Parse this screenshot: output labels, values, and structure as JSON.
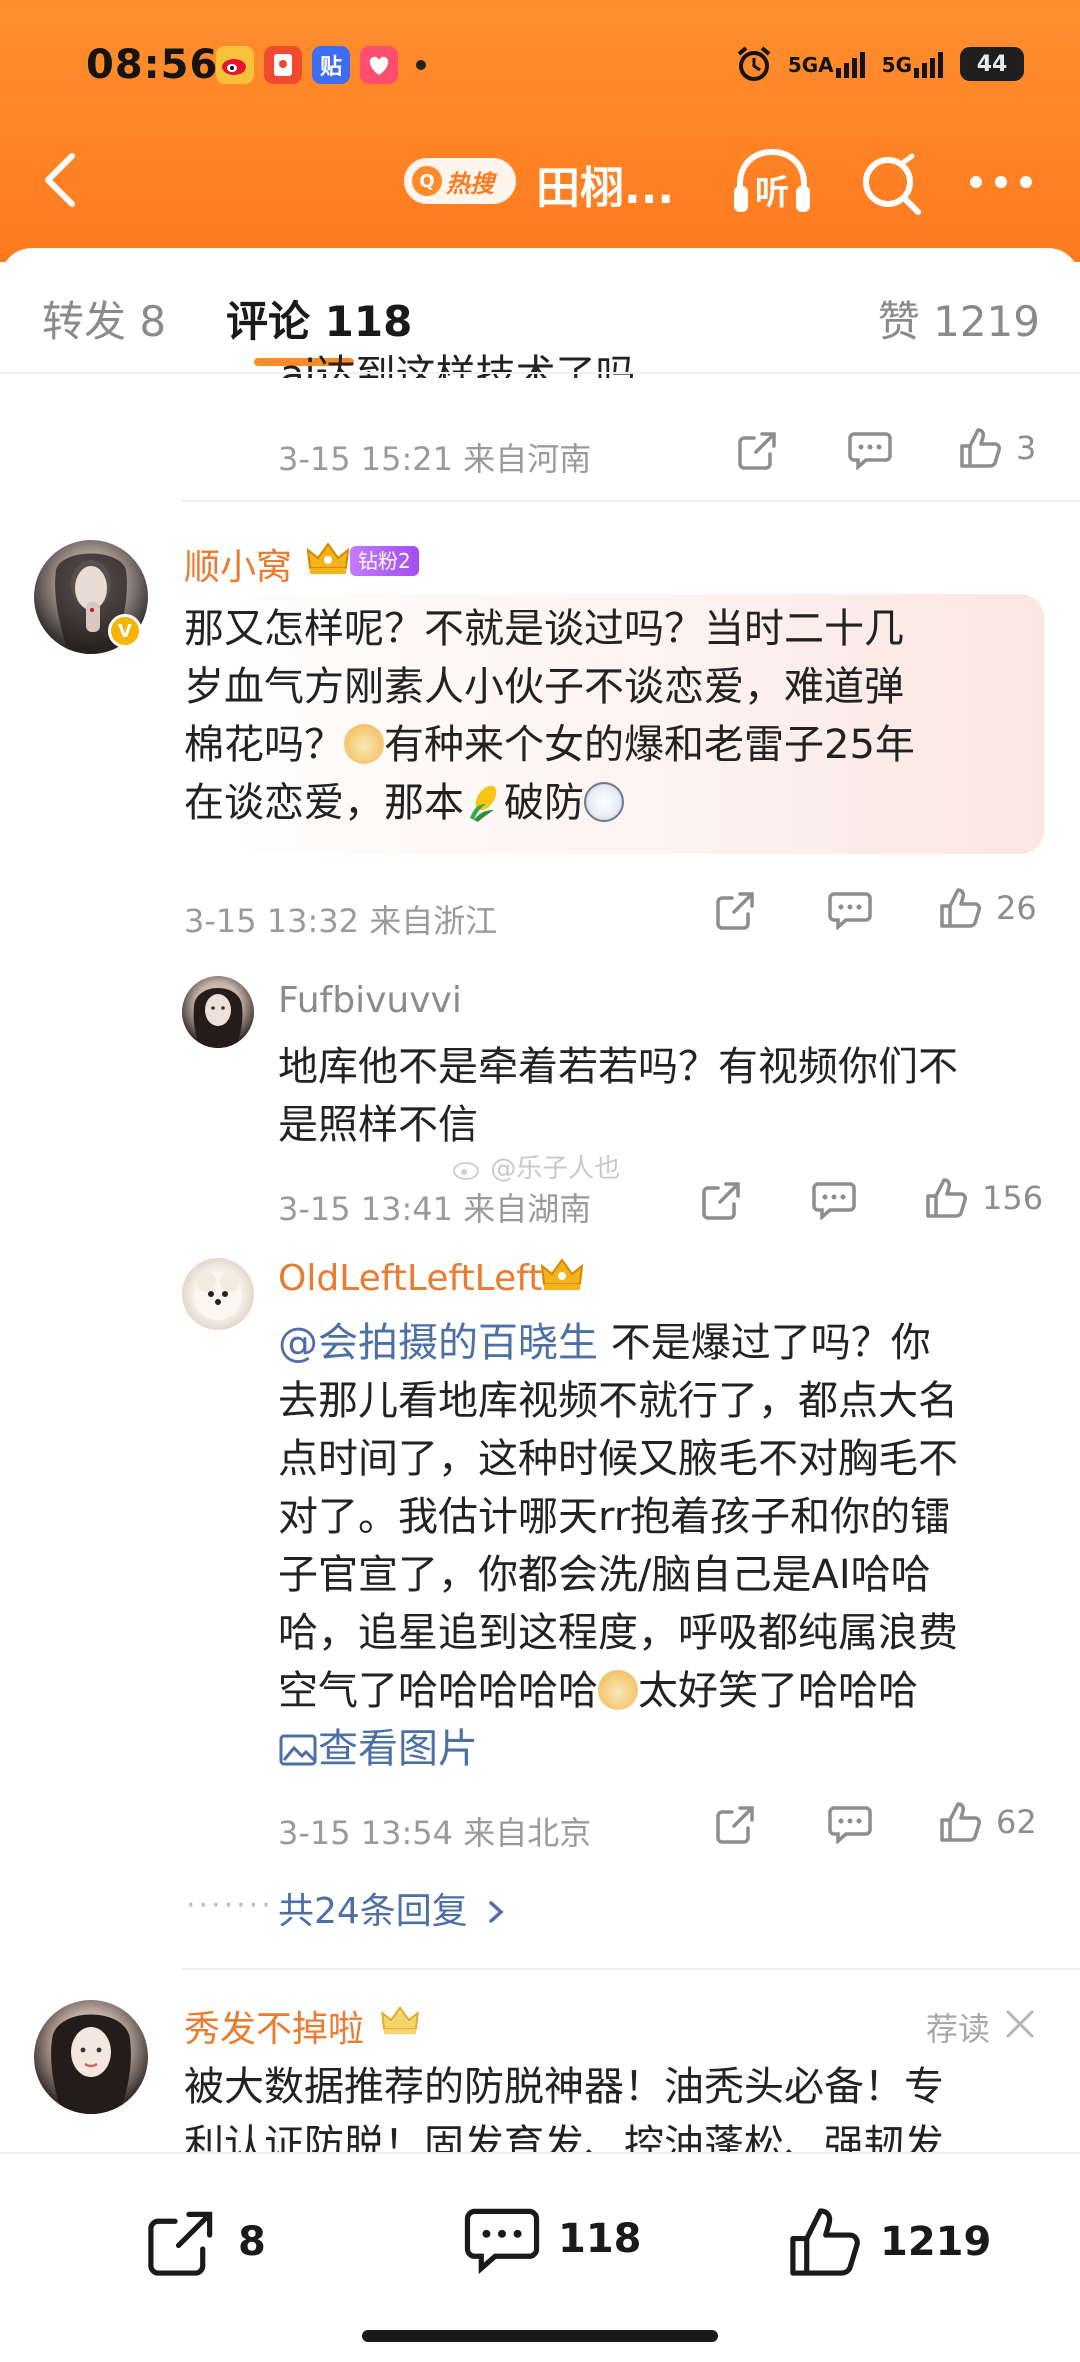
{
  "status": {
    "time": "08:56",
    "battery": "44",
    "signal1": "5GA",
    "signal2": "5G"
  },
  "nav": {
    "hot_label": "热搜",
    "title": "田栩...",
    "listen_label": "听"
  },
  "tabs": {
    "repost": "转发 8",
    "comment": "评论 118",
    "like": "赞 1219"
  },
  "prev_comment": {
    "text_cut": "ai达到这样技术了吗",
    "meta": "3-15 15:21  来自河南",
    "likes": "3"
  },
  "comments": [
    {
      "user": "顺小窝",
      "fan_badge": "钻粉2",
      "text_line1": "那又怎样呢？不就是谈过吗？当时二十几",
      "text_line2": "岁血气方刚素人小伙子不谈恋爱，难道弹",
      "text_line3a": "棉花吗？",
      "text_line3b": "有种来个女的爆和老雷子25年",
      "text_line4a": "在谈恋爱，那本",
      "text_line4b": "破防",
      "meta": "3-15 13:32  来自浙江",
      "likes": "26"
    }
  ],
  "replies": [
    {
      "user": "Fufbivuvvi",
      "text_line1": "地库他不是牵着若若吗？有视频你们不",
      "text_line2": "是照样不信",
      "meta": "3-15 13:41  来自湖南",
      "likes": "156"
    },
    {
      "user": "OldLeftLeftLeft",
      "mention": "@会拍摄的百晓生",
      "text_line1_rest": " 不是爆过了吗？你",
      "text_line2": "去那儿看地库视频不就行了，都点大名",
      "text_line3": "点时间了，这种时候又腋毛不对胸毛不",
      "text_line4": "对了。我估计哪天rr抱着孩子和你的镭",
      "text_line5": "子官宣了，你都会洗/脑自己是AI哈哈",
      "text_line6": "哈，追星追到这程度，呼吸都纯属浪费",
      "text_line7a": "空气了哈哈哈哈哈",
      "text_line7b": "太好笑了哈哈哈",
      "view_image": "查看图片",
      "meta": "3-15 13:54  来自北京",
      "likes": "62"
    }
  ],
  "more_replies": "共24条回复",
  "watermark": "@乐子人也",
  "ad": {
    "user": "秀发不掉啦",
    "tag": "荐读",
    "text_line1": "被大数据推荐的防脱神器！油秃头必备！专",
    "text_line2": "利认证防脱！固发育发、控油蓬松、强韧发"
  },
  "bottom": {
    "repost": "8",
    "comment": "118",
    "like": "1219"
  },
  "colors": {
    "accent": "#ff7a1f",
    "username": "#eb7b2e",
    "link": "#4c6fa6"
  }
}
